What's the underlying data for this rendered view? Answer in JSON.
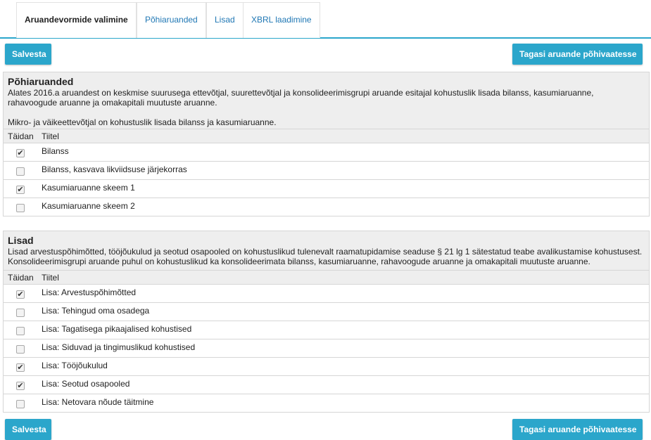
{
  "tabs": [
    {
      "label": "Aruandevormide valimine",
      "active": true
    },
    {
      "label": "Põhiaruanded",
      "active": false
    },
    {
      "label": "Lisad",
      "active": false
    },
    {
      "label": "XBRL laadimine",
      "active": false
    }
  ],
  "buttons": {
    "save": "Salvesta",
    "back": "Tagasi aruande põhivaatesse"
  },
  "columns": {
    "fill": "Täidan",
    "title": "Tiitel"
  },
  "main_reports": {
    "title": "Põhiaruanded",
    "desc1": "Alates 2016.a aruandest on keskmise suurusega ettevõtjal, suurettevõtjal ja konsolideerimisgrupi aruande esitajal kohustuslik lisada bilanss, kasumiaruanne, rahavoogude aruanne ja omakapitali muutuste aruanne.",
    "desc2": "Mikro- ja väikeettevõtjal on kohustuslik lisada bilanss ja kasumiaruanne.",
    "items": [
      {
        "label": "Bilanss",
        "checked": true
      },
      {
        "label": "Bilanss, kasvava likviidsuse järjekorras",
        "checked": false
      },
      {
        "label": "Kasumiaruanne skeem 1",
        "checked": true
      },
      {
        "label": "Kasumiaruanne skeem 2",
        "checked": false
      }
    ]
  },
  "notes": {
    "title": "Lisad",
    "desc1": "Lisad arvestuspõhimõtted, tööjõukulud ja seotud osapooled on kohustuslikud tulenevalt raamatupidamise seaduse § 21 lg 1 sätestatud teabe avalikustamise kohustusest.",
    "desc2": "Konsolideerimisgrupi aruande puhul on kohustuslikud ka konsolideerimata bilanss, kasumiaruanne, rahavoogude aruanne ja omakapitali muutuste aruanne.",
    "items": [
      {
        "label": "Lisa: Arvestuspõhimõtted",
        "checked": true
      },
      {
        "label": "Lisa: Tehingud oma osadega",
        "checked": false
      },
      {
        "label": "Lisa: Tagatisega pikaajalised kohustised",
        "checked": false
      },
      {
        "label": "Lisa: Siduvad ja tingimuslikud kohustised",
        "checked": false
      },
      {
        "label": "Lisa: Tööjõukulud",
        "checked": true
      },
      {
        "label": "Lisa: Seotud osapooled",
        "checked": true
      },
      {
        "label": "Lisa: Netovara nõude täitmine",
        "checked": false
      }
    ]
  }
}
